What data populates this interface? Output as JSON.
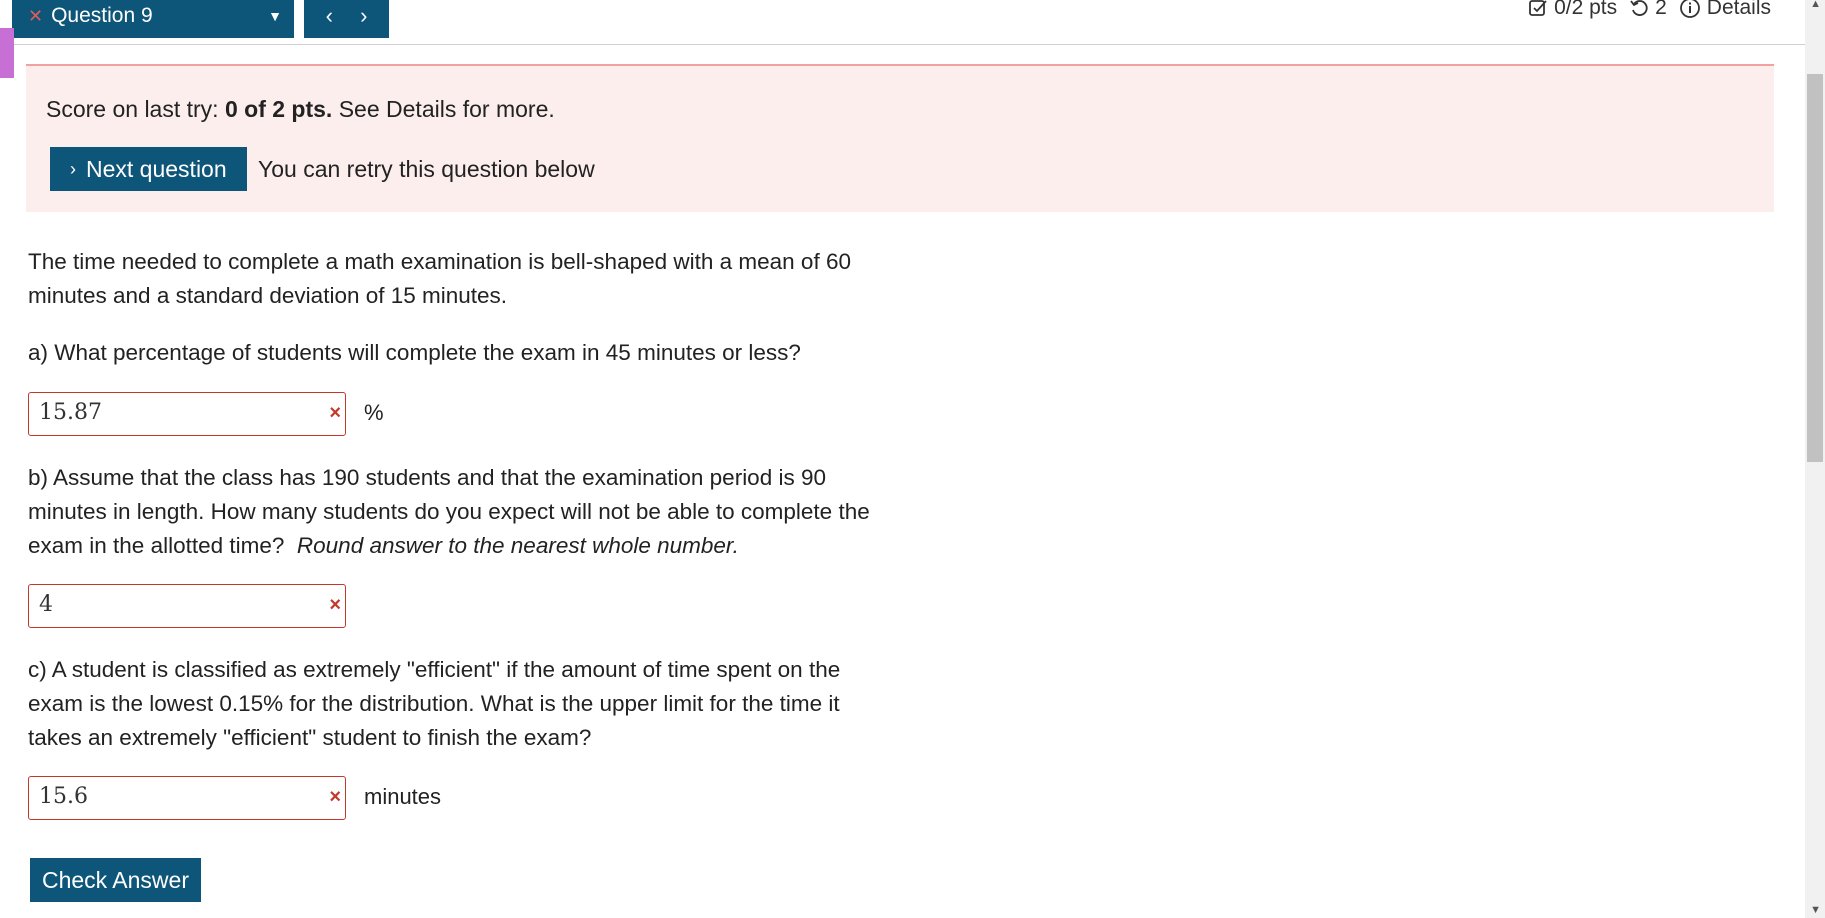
{
  "header": {
    "question_label": "Question 9",
    "prev_glyph": "‹",
    "next_glyph": "›",
    "points": "0/2 pts",
    "attempts": "2",
    "details_label": "Details"
  },
  "alert": {
    "score_prefix": "Score on last try: ",
    "score_value": "0 of 2 pts.",
    "score_suffix": " See Details for more.",
    "next_button": "Next question",
    "retry_text": "You can retry this question below"
  },
  "question": {
    "intro_line1": "The time needed to complete a math examination is bell-shaped with a mean of 60",
    "intro_line2": "minutes and a standard deviation of 15 minutes.",
    "part_a": "a) What percentage of students will complete the exam in 45 minutes or less?",
    "answer_a": "15.87",
    "unit_a": "%",
    "part_b_line1": "b) Assume that the class has 190 students and that the examination period is 90",
    "part_b_line2": "minutes in length. How many students do you expect will not be able to complete the",
    "part_b_line3": "exam in the allotted time?",
    "part_b_hint": "Round answer to the nearest whole number.",
    "answer_b": "4",
    "part_c_line1": "c) A student is classified as extremely \"efficient\" if the amount of time spent on the",
    "part_c_line2": "exam is the lowest 0.15% for the distribution. What is the upper limit for the time it",
    "part_c_line3": "takes an extremely \"efficient\" student to finish the exam?",
    "answer_c": "15.6",
    "unit_c": "minutes"
  },
  "check_button": "Check Answer",
  "icons": {
    "wrong": "×",
    "question_x": "✕",
    "dropdown": "▼"
  },
  "colors": {
    "primary": "#0d5579",
    "alert_bg": "#fdeeee",
    "error": "#c0392b"
  }
}
